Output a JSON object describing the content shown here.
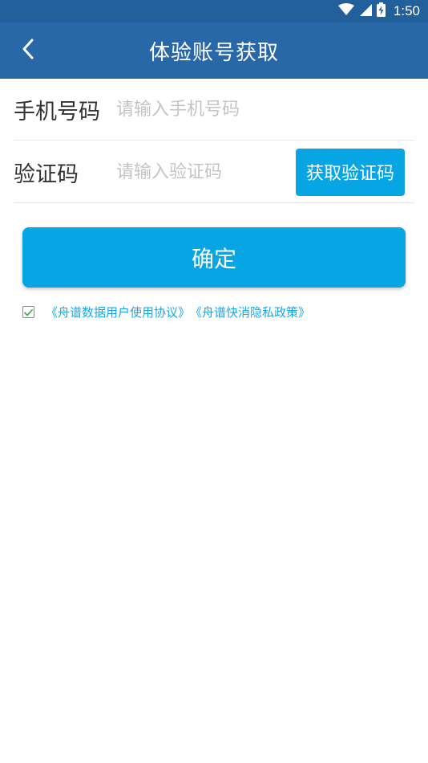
{
  "status_bar": {
    "time": "1:50",
    "icons": [
      "wifi-icon",
      "signal-icon",
      "battery-icon"
    ]
  },
  "app_bar": {
    "title": "体验账号获取",
    "back_icon": "chevron-left-icon"
  },
  "form": {
    "phone": {
      "label": "手机号码",
      "value": "",
      "placeholder": "请输入手机号码"
    },
    "code": {
      "label": "验证码",
      "value": "",
      "placeholder": "请输入验证码",
      "button_label": "获取验证码"
    }
  },
  "confirm_label": "确定",
  "agreement": {
    "checked": true,
    "check_icon": "check-icon",
    "user_agreement": "《舟谱数据用户使用协议》",
    "privacy_policy": "《舟谱快消隐私政策》"
  },
  "colors": {
    "status_bar": "#22609c",
    "app_bar": "#2868a8",
    "accent": "#08a5e4",
    "link": "#1aa7e6",
    "check": "#4caf50"
  }
}
